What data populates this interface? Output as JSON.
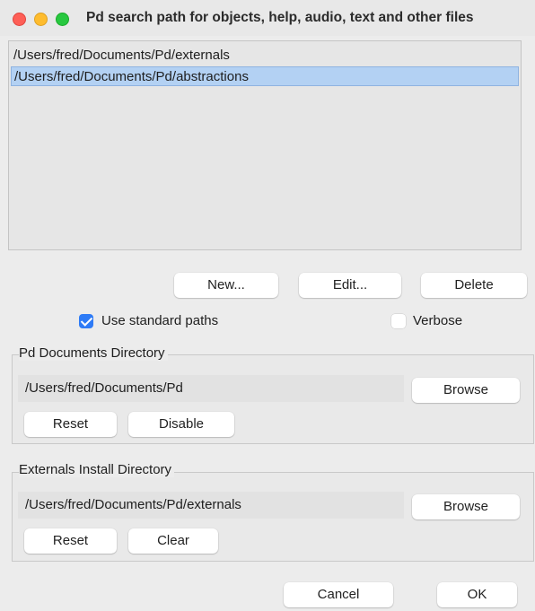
{
  "window": {
    "title": "Pd search path for objects, help, audio, text and other files"
  },
  "path_list": {
    "items": [
      {
        "label": "/Users/fred/Documents/Pd/externals",
        "selected": false
      },
      {
        "label": "/Users/fred/Documents/Pd/abstractions",
        "selected": true
      }
    ]
  },
  "list_buttons": {
    "new_label": "New...",
    "edit_label": "Edit...",
    "delete_label": "Delete"
  },
  "options": {
    "use_standard_paths_label": "Use standard paths",
    "use_standard_paths_checked": true,
    "verbose_label": "Verbose",
    "verbose_checked": false
  },
  "documents_dir": {
    "title": "Pd Documents Directory",
    "path": "/Users/fred/Documents/Pd",
    "browse_label": "Browse",
    "reset_label": "Reset",
    "disable_label": "Disable"
  },
  "externals_dir": {
    "title": "Externals Install Directory",
    "path": "/Users/fred/Documents/Pd/externals",
    "browse_label": "Browse",
    "reset_label": "Reset",
    "clear_label": "Clear"
  },
  "footer": {
    "cancel_label": "Cancel",
    "ok_label": "OK"
  },
  "colors": {
    "selection": "#b3d1f3",
    "checkbox_accent": "#2e7bf6",
    "close": "#fe5f57",
    "minimize": "#febc2e",
    "zoom": "#28c840"
  }
}
